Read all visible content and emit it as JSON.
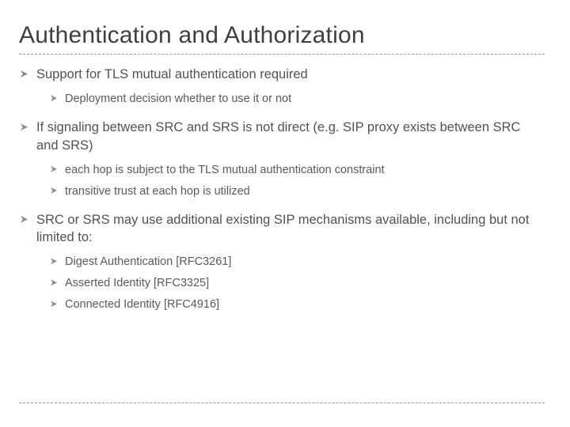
{
  "title": "Authentication and Authorization",
  "bullets": [
    {
      "text": "Support for TLS mutual authentication required",
      "children": [
        "Deployment decision whether to use it or not"
      ]
    },
    {
      "text": "If signaling between SRC and SRS is not direct (e.g. SIP proxy exists between SRC and SRS)",
      "children": [
        "each hop is subject to the TLS mutual authentication constraint",
        "transitive trust at each hop is utilized"
      ]
    },
    {
      "text": "SRC or SRS may use additional existing SIP mechanisms available, including but not limited to:",
      "children": [
        "Digest Authentication [RFC3261]",
        "Asserted Identity [RFC3325]",
        "Connected Identity [RFC4916]"
      ]
    }
  ]
}
